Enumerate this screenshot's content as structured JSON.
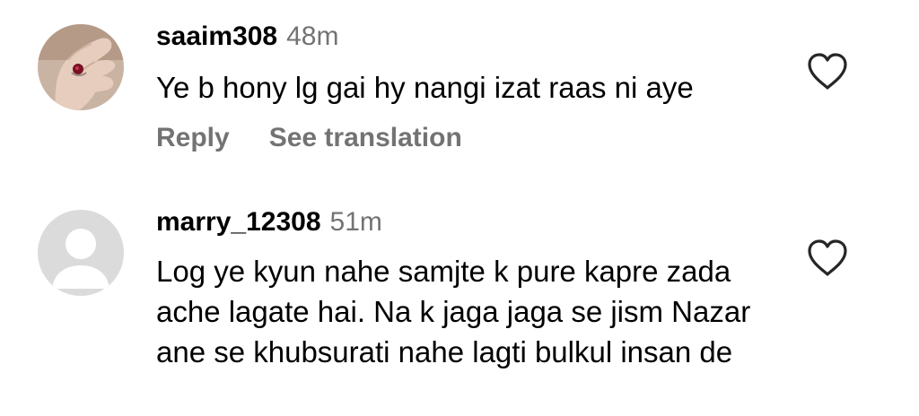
{
  "comments": [
    {
      "username": "saaim308",
      "time": "48m",
      "text": "Ye b hony lg gai hy nangi izat raas ni aye",
      "reply_label": "Reply",
      "translation_label": "See translation",
      "like_icon": "heart-outline-icon",
      "avatar": "hand-with-ring-photo"
    },
    {
      "username": "marry_12308",
      "time": "51m",
      "text": "Log ye kyun nahe samjte k pure kapre zada ache lagate hai. Na k jaga jaga se jism Nazar ane se khubsurati nahe lagti bulkul insan de",
      "like_icon": "heart-outline-icon",
      "avatar": "default-profile-avatar"
    }
  ],
  "colors": {
    "username": "#000000",
    "secondary_text": "#737373",
    "default_avatar_bg": "#dbdbdb"
  }
}
